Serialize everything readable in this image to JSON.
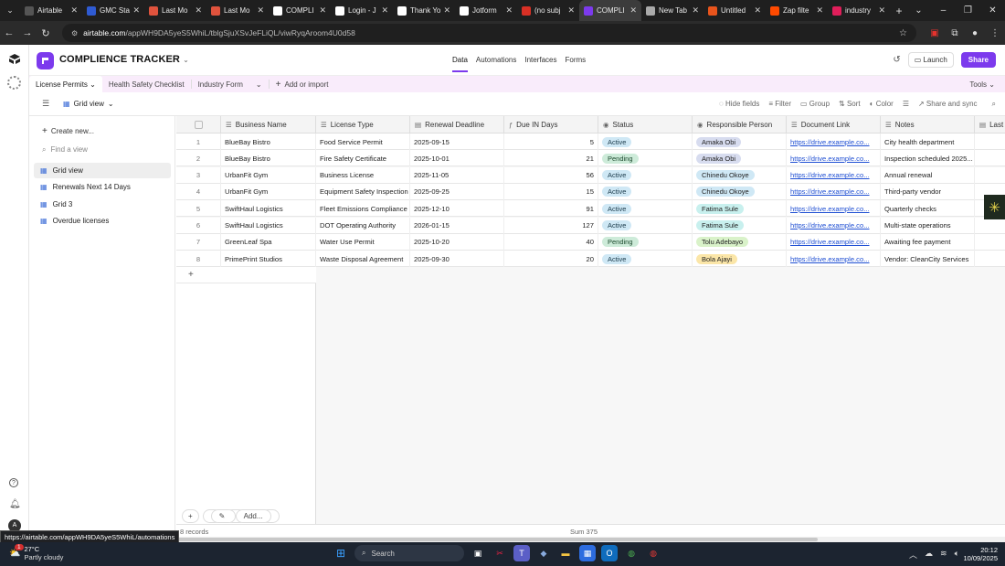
{
  "browser": {
    "tabs": [
      {
        "title": "Airtable",
        "color": "#555555",
        "active": false
      },
      {
        "title": "GMC Sta",
        "color": "#2f5bd3",
        "active": false
      },
      {
        "title": "Last Mo",
        "color": "#e0533d",
        "active": false
      },
      {
        "title": "Last Mo",
        "color": "#e0533d",
        "active": false
      },
      {
        "title": "COMPLI",
        "color": "#ffffff",
        "active": false
      },
      {
        "title": "Login - J",
        "color": "#ffffff",
        "active": false
      },
      {
        "title": "Thank Yo",
        "color": "#ffffff",
        "active": false
      },
      {
        "title": "Jotform",
        "color": "#ffffff",
        "active": false
      },
      {
        "title": "(no subj",
        "color": "#d93025",
        "active": false
      },
      {
        "title": "COMPLI",
        "color": "#7c3aed",
        "active": true
      },
      {
        "title": "New Tab",
        "color": "#aaaaaa",
        "active": false
      },
      {
        "title": "Untitled",
        "color": "#e8541c",
        "active": false
      },
      {
        "title": "Zap filte",
        "color": "#ff4a00",
        "active": false
      },
      {
        "title": "industry",
        "color": "#e01e5a",
        "active": false
      }
    ],
    "url_domain": "airtable.com",
    "url_path": "/appWH9DA5yeS5WhiL/tblgSjuXSvJeFLiQL/viwRyqAroom4U0d58",
    "status_url": "https://airtable.com/appWH9DA5yeS5WhiL/automations"
  },
  "app": {
    "base_title": "COMPLIENCE TRACKER",
    "header_tabs": [
      "Data",
      "Automations",
      "Interfaces",
      "Forms"
    ],
    "launch_label": "Launch",
    "share_label": "Share",
    "brand_color": "#7c3aed"
  },
  "tables": {
    "items": [
      "License Permits",
      "Health Safety Checklist",
      "Industry Form"
    ],
    "add_label": "Add or import",
    "tools_label": "Tools"
  },
  "toolbar": {
    "view_name": "Grid view",
    "hide_fields": "Hide fields",
    "filter": "Filter",
    "group": "Group",
    "sort": "Sort",
    "color": "Color",
    "share_sync": "Share and sync"
  },
  "views": {
    "create_label": "Create new...",
    "find_placeholder": "Find a view",
    "items": [
      "Grid view",
      "Renewals Next 14 Days",
      "Grid 3",
      "Overdue licenses"
    ]
  },
  "grid": {
    "columns": [
      "Business Name",
      "License Type",
      "Renewal Deadline",
      "Due IN Days",
      "Status",
      "Responsible Person",
      "Document Link",
      "Notes",
      "Last"
    ],
    "rows": [
      {
        "n": "1",
        "business": "BlueBay Bistro",
        "license": "Food Service Permit",
        "deadline": "2025-09-15",
        "due": "5",
        "status": "Active",
        "person": "Amaka Obi",
        "link": "https://drive.example.co...",
        "notes": "City health department"
      },
      {
        "n": "2",
        "business": "BlueBay Bistro",
        "license": "Fire Safety Certificate",
        "deadline": "2025-10-01",
        "due": "21",
        "status": "Pending",
        "person": "Amaka Obi",
        "link": "https://drive.example.co...",
        "notes": "Inspection scheduled 2025..."
      },
      {
        "n": "3",
        "business": "UrbanFit Gym",
        "license": "Business License",
        "deadline": "2025-11-05",
        "due": "56",
        "status": "Active",
        "person": "Chinedu Okoye",
        "link": "https://drive.example.co...",
        "notes": "Annual renewal"
      },
      {
        "n": "4",
        "business": "UrbanFit Gym",
        "license": "Equipment Safety Inspection",
        "deadline": "2025-09-25",
        "due": "15",
        "status": "Active",
        "person": "Chinedu Okoye",
        "link": "https://drive.example.co...",
        "notes": "Third-party vendor"
      },
      {
        "n": "5",
        "business": "SwiftHaul Logistics",
        "license": "Fleet Emissions Compliance",
        "deadline": "2025-12-10",
        "due": "91",
        "status": "Active",
        "person": "Fatima Sule",
        "link": "https://drive.example.co...",
        "notes": "Quarterly checks"
      },
      {
        "n": "6",
        "business": "SwiftHaul Logistics",
        "license": "DOT Operating Authority",
        "deadline": "2026-01-15",
        "due": "127",
        "status": "Active",
        "person": "Fatima Sule",
        "link": "https://drive.example.co...",
        "notes": "Multi-state operations"
      },
      {
        "n": "7",
        "business": "GreenLeaf Spa",
        "license": "Water Use Permit",
        "deadline": "2025-10-20",
        "due": "40",
        "status": "Pending",
        "person": "Tolu Adebayo",
        "link": "https://drive.example.co...",
        "notes": "Awaiting fee payment"
      },
      {
        "n": "8",
        "business": "PrimePrint Studios",
        "license": "Waste Disposal Agreement",
        "deadline": "2025-09-30",
        "due": "20",
        "status": "Active",
        "person": "Bola Ajayi",
        "link": "https://drive.example.co...",
        "notes": "Vendor: CleanCity Services"
      }
    ],
    "person_colors": {
      "Amaka Obi": "#d7dcef",
      "Chinedu Okoye": "#cfe8f5",
      "Fatima Sule": "#c8f0ee",
      "Tolu Adebayo": "#d9f2c9",
      "Bola Ajayi": "#fbe6a8"
    },
    "records_label": "8 records",
    "sum_label": "Sum 375",
    "add_label": "Add..."
  },
  "taskbar": {
    "temperature": "27°C",
    "weather": "Partly cloudy",
    "search_label": "Search",
    "time": "20:12",
    "date": "10/09/2025",
    "notification_count": "1"
  }
}
